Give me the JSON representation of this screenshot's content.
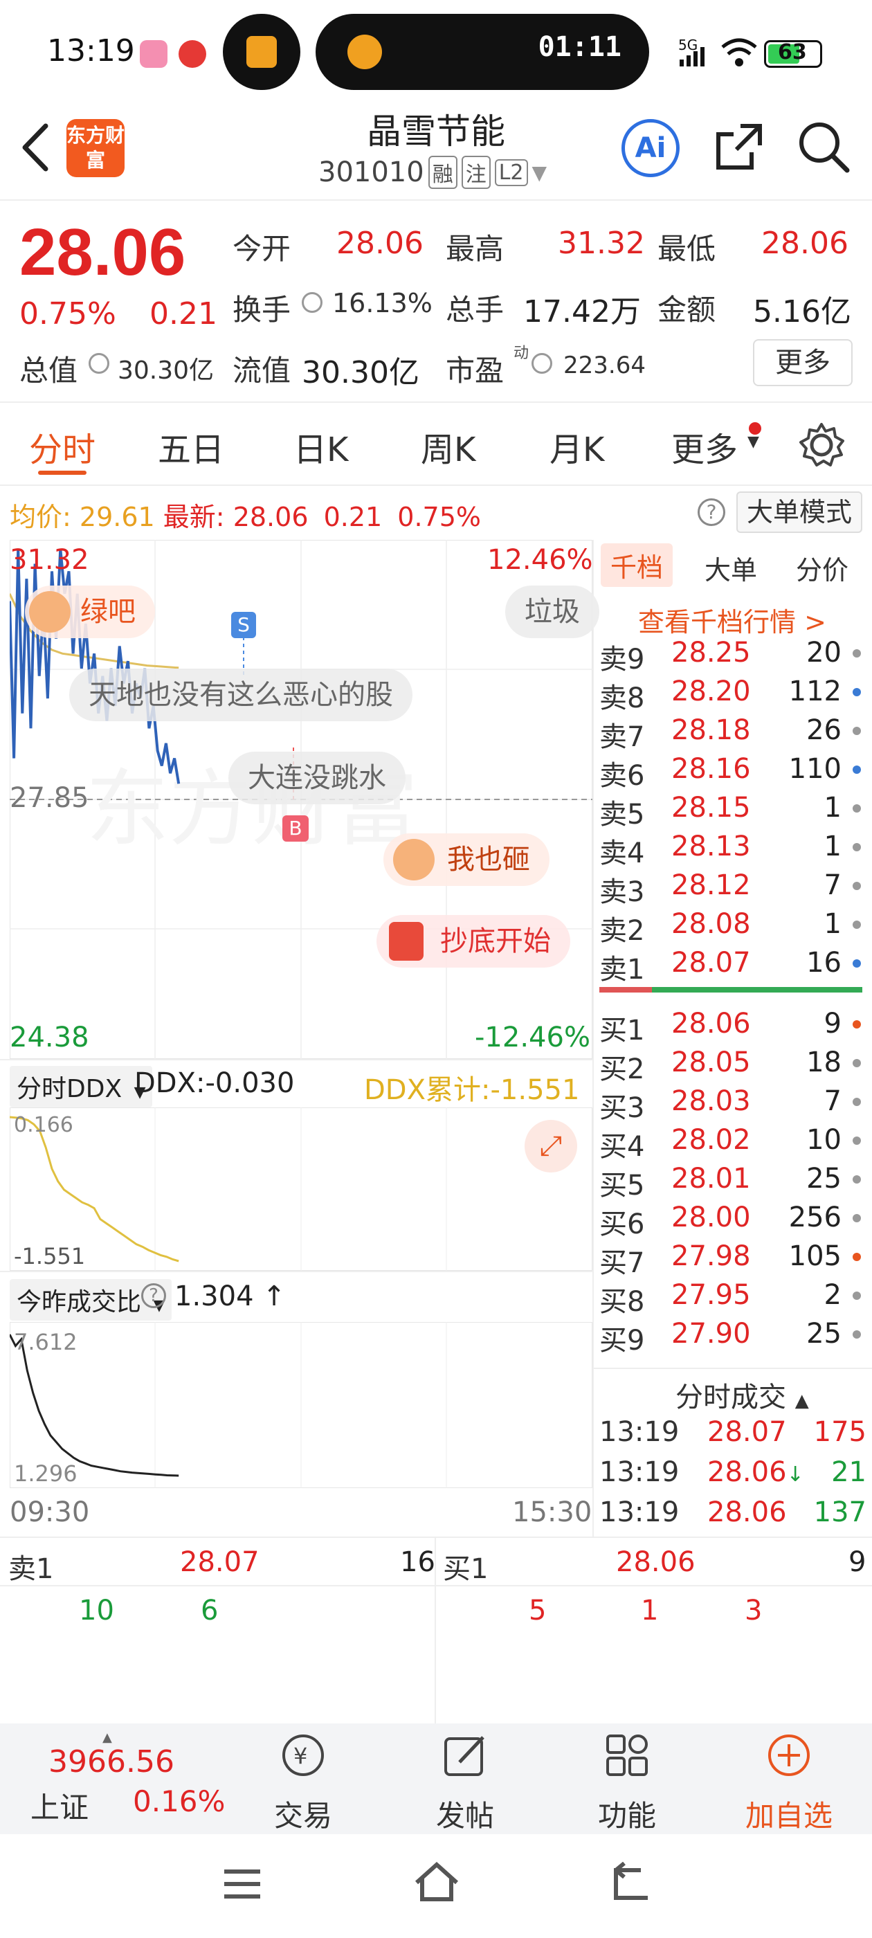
{
  "status_bar": {
    "time": "13:19",
    "timer": "01:11",
    "battery": "63",
    "network": "5G"
  },
  "header": {
    "back_icon": "back-arrow-icon",
    "logo": "东方财富",
    "stock_name": "晶雪节能",
    "stock_code": "301010",
    "tags": [
      "融",
      "注",
      "L2"
    ],
    "ai_icon": "ai-icon",
    "share_icon": "share-icon",
    "search_icon": "search-icon"
  },
  "quote": {
    "price": "28.06",
    "change_pct": "0.75%",
    "change": "0.21",
    "open_label": "今开",
    "open": "28.06",
    "high_label": "最高",
    "high": "31.32",
    "low_label": "最低",
    "low": "28.06",
    "turnover_label": "换手",
    "turnover": "16.13%",
    "volume_label": "总手",
    "volume": "17.42万",
    "amount_label": "金额",
    "amount": "5.16亿",
    "mktcap_label": "总值",
    "mktcap": "30.30亿",
    "float_label": "流值",
    "float": "30.30亿",
    "pe_label": "市盈",
    "pe_sup": "动",
    "pe": "223.64",
    "more_label": "更多"
  },
  "tabs": [
    "分时",
    "五日",
    "日K",
    "周K",
    "月K",
    "更多"
  ],
  "avg_bar": {
    "avg_label": "均价:",
    "avg": "29.61",
    "latest_label": "最新:",
    "latest": "28.06",
    "change": "0.21",
    "change_pct": "0.75%",
    "mode_btn": "大单模式"
  },
  "chart_data": {
    "type": "line",
    "title": "",
    "x_start": "09:30",
    "x_end": "15:30",
    "y_max": "31.32",
    "y_max_pct": "12.46%",
    "y_ref": "27.85",
    "y_min": "24.38",
    "y_min_pct": "-12.46%",
    "ylim": [
      24.38,
      31.32
    ],
    "series": [
      {
        "values": [
          30.5,
          28.4,
          31.2,
          29.0,
          30.8,
          28.8,
          31.0,
          29.5,
          30.4,
          29.2,
          30.9,
          30.0,
          31.2,
          30.6,
          30.9,
          29.8,
          30.6,
          29.6,
          30.2,
          29.4,
          29.8,
          29.0,
          29.5,
          28.9,
          29.6,
          29.1,
          29.9,
          29.4,
          29.7,
          29.0,
          29.4,
          29.2,
          29.6,
          28.8,
          29.1,
          28.5,
          28.3,
          28.6,
          28.2,
          28.4,
          28.06
        ]
      },
      {
        "values": [
          30.6,
          30.3,
          30.1,
          29.95,
          29.85,
          29.8,
          29.78,
          29.76,
          29.74,
          29.72,
          29.7,
          29.68,
          29.66,
          29.64,
          29.63,
          29.62,
          29.61
        ]
      }
    ],
    "markers": [
      {
        "label": "S"
      },
      {
        "label": "B"
      }
    ],
    "comments": [
      {
        "text": "绿吧",
        "style": "pink"
      },
      {
        "text": "垃圾",
        "style": "gray"
      },
      {
        "text": "天地也没有这么恶心的股",
        "style": "gray"
      },
      {
        "text": "大连没跳水",
        "style": "gray"
      },
      {
        "text": "我也砸",
        "style": "pink"
      },
      {
        "text": "抄底开始",
        "style": "pinkish"
      }
    ]
  },
  "depth": {
    "tabs": [
      "千档",
      "大单",
      "分价"
    ],
    "link": "查看千档行情 >",
    "asks": [
      {
        "label": "卖9",
        "price": "28.25",
        "vol": "20",
        "dot": "#999999"
      },
      {
        "label": "卖8",
        "price": "28.20",
        "vol": "112",
        "dot": "#3a7bd5"
      },
      {
        "label": "卖7",
        "price": "28.18",
        "vol": "26",
        "dot": "#999999"
      },
      {
        "label": "卖6",
        "price": "28.16",
        "vol": "110",
        "dot": "#3a7bd5"
      },
      {
        "label": "卖5",
        "price": "28.15",
        "vol": "1",
        "dot": "#999999"
      },
      {
        "label": "卖4",
        "price": "28.13",
        "vol": "1",
        "dot": "#999999"
      },
      {
        "label": "卖3",
        "price": "28.12",
        "vol": "7",
        "dot": "#999999"
      },
      {
        "label": "卖2",
        "price": "28.08",
        "vol": "1",
        "dot": "#999999"
      },
      {
        "label": "卖1",
        "price": "28.07",
        "vol": "16",
        "dot": "#3a7bd5"
      }
    ],
    "bids": [
      {
        "label": "买1",
        "price": "28.06",
        "vol": "9",
        "dot": "#e8551f"
      },
      {
        "label": "买2",
        "price": "28.05",
        "vol": "18",
        "dot": "#999999"
      },
      {
        "label": "买3",
        "price": "28.03",
        "vol": "7",
        "dot": "#999999"
      },
      {
        "label": "买4",
        "price": "28.02",
        "vol": "10",
        "dot": "#999999"
      },
      {
        "label": "买5",
        "price": "28.01",
        "vol": "25",
        "dot": "#999999"
      },
      {
        "label": "买6",
        "price": "28.00",
        "vol": "256",
        "dot": "#999999"
      },
      {
        "label": "买7",
        "price": "27.98",
        "vol": "105",
        "dot": "#e8551f"
      },
      {
        "label": "买8",
        "price": "27.95",
        "vol": "2",
        "dot": "#999999"
      },
      {
        "label": "买9",
        "price": "27.90",
        "vol": "25",
        "dot": "#999999"
      }
    ],
    "trades_title": "分时成交",
    "trades": [
      {
        "time": "13:19",
        "price": "28.07",
        "vol": "175",
        "color": "#e02424",
        "arrow": ""
      },
      {
        "time": "13:19",
        "price": "28.06",
        "vol": "21",
        "color": "#1a9b3a",
        "arrow": "↓"
      },
      {
        "time": "13:19",
        "price": "28.06",
        "vol": "137",
        "color": "#1a9b3a",
        "arrow": ""
      }
    ]
  },
  "ddx": {
    "select": "分时DDX",
    "ddx_label": "DDX:-0.030",
    "ddx_cum_label": "DDX累计:-1.551",
    "top_val": "0.166",
    "bottom_val": "-1.551",
    "series": [
      0.166,
      0.16,
      0.15,
      0.13,
      0.08,
      0.0,
      -0.2,
      -0.45,
      -0.6,
      -0.7,
      -0.75,
      -0.8,
      -0.85,
      -0.88,
      -0.92,
      -1.05,
      -1.1,
      -1.15,
      -1.2,
      -1.25,
      -1.3,
      -1.35,
      -1.38,
      -1.42,
      -1.45,
      -1.48,
      -1.5,
      -1.53,
      -1.551
    ]
  },
  "ratio": {
    "select": "今昨成交比",
    "value": "1.304",
    "arrow": "↑",
    "top_val": "7.612",
    "bottom_val": "1.296",
    "series": [
      7.612,
      7.1,
      7.4,
      6.0,
      5.0,
      4.2,
      3.6,
      3.1,
      2.8,
      2.5,
      2.3,
      2.1,
      1.95,
      1.85,
      1.75,
      1.7,
      1.65,
      1.6,
      1.55,
      1.5,
      1.47,
      1.44,
      1.42,
      1.4,
      1.38,
      1.36,
      1.34,
      1.32,
      1.31,
      1.304
    ]
  },
  "queue": {
    "left_label": "卖1",
    "left_price": "28.07",
    "left_vol": "16",
    "left_items": [
      "10",
      "6"
    ],
    "right_label": "买1",
    "right_price": "28.06",
    "right_vol": "9",
    "right_items": [
      "5",
      "1",
      "3"
    ]
  },
  "nav": {
    "index_value": "3966.56",
    "index_name": "上证",
    "index_change": "0.16%",
    "items": [
      {
        "label": "交易",
        "icon": "trade-icon"
      },
      {
        "label": "发帖",
        "icon": "post-icon"
      },
      {
        "label": "功能",
        "icon": "apps-icon"
      },
      {
        "label": "加自选",
        "icon": "add-favorite-icon"
      }
    ]
  },
  "colors": {
    "up": "#e02424",
    "down": "#1a9b3a",
    "accent": "#e8551f",
    "price_line": "#2f62b8",
    "avg_line": "#e0c060"
  }
}
